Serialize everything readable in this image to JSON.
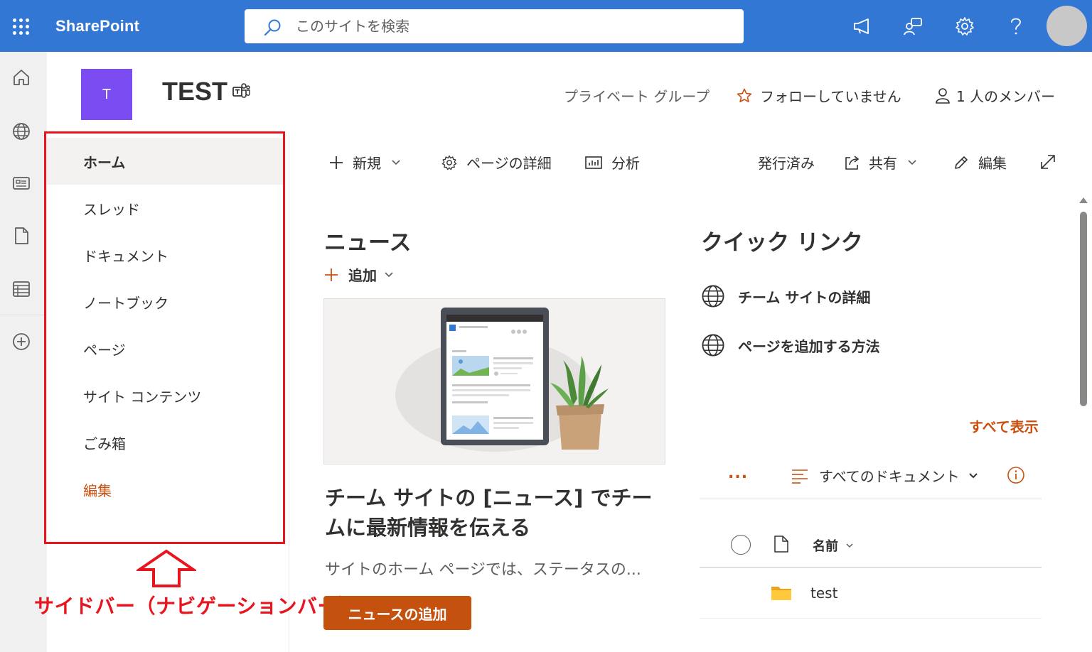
{
  "suitebar": {
    "brand": "SharePoint",
    "search_placeholder": "このサイトを検索",
    "icons": [
      "waffle-icon",
      "megaphone-icon",
      "chat-icon",
      "gear-icon",
      "help-icon",
      "avatar"
    ]
  },
  "appbar": {
    "icons": [
      "home-icon",
      "globe-icon",
      "news-icon",
      "document-icon",
      "list-icon",
      "create-icon"
    ]
  },
  "site": {
    "logo_letter": "T",
    "title": "TEST",
    "privacy": "プライベート グループ",
    "follow": "フォローしていません",
    "members": "1 人のメンバー"
  },
  "nav": {
    "items": [
      {
        "label": "ホーム",
        "active": true
      },
      {
        "label": "スレッド"
      },
      {
        "label": "ドキュメント"
      },
      {
        "label": "ノートブック"
      },
      {
        "label": "ページ"
      },
      {
        "label": "サイト コンテンツ"
      },
      {
        "label": "ごみ箱"
      }
    ],
    "edit_label": "編集"
  },
  "annotation": {
    "label": "サイドバー（ナビゲーションバー）",
    "color": "#e8141e"
  },
  "command_bar": {
    "new": "新規",
    "page_details": "ページの詳細",
    "analytics": "分析",
    "status": "発行済み",
    "share": "共有",
    "edit": "編集"
  },
  "news": {
    "title": "ニュース",
    "add": "追加",
    "headline": "チーム サイトの [ニュース] でチームに最新情報を伝える",
    "description": "サイトのホーム ページでは、ステータスの...",
    "button": "ニュースの追加"
  },
  "quick_links": {
    "title": "クイック リンク",
    "items": [
      "チーム サイトの詳細",
      "ページを追加する方法"
    ]
  },
  "documents": {
    "see_all": "すべて表示",
    "more": "...",
    "view": "すべてのドキュメント",
    "column_name": "名前",
    "rows": [
      {
        "name": "test",
        "type": "folder"
      }
    ]
  },
  "colors": {
    "suite_blue": "#3277d4",
    "site_logo": "#7b4cf2",
    "accent_orange": "#ca5010",
    "button_orange": "#c4520e"
  }
}
